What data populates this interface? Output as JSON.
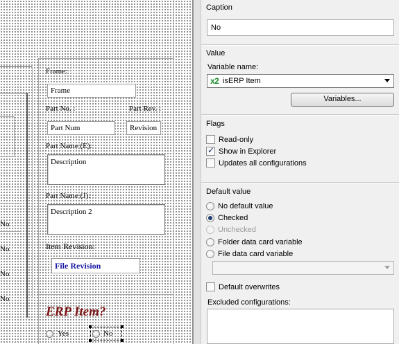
{
  "canvas": {
    "frame_label": "Frame:",
    "frame_value": "Frame",
    "part_no_label": "Part No. :",
    "part_rev_label": "Part Rev. :",
    "part_num_value": "Part Num",
    "revision_value": "Revision",
    "part_name_e_label": "Part Name (E):",
    "description_value": "Description",
    "part_name_j_label": "Part Name (J):",
    "description2_value": "Description 2",
    "item_revision_label": "Item Revision:",
    "file_revision_value": "File Revision",
    "edge_no_labels": [
      "No",
      "No",
      "No",
      "No"
    ],
    "erp_title": "ERP Item?",
    "yes_label": "Yes",
    "no_label": "No"
  },
  "panel": {
    "caption": {
      "title": "Caption",
      "value": "No"
    },
    "value": {
      "title": "Value",
      "variable_name_label": "Variable name:",
      "variable_icon": "x2",
      "variable_value": "isERP Item",
      "variables_button": "Variables..."
    },
    "flags": {
      "title": "Flags",
      "items": [
        {
          "label": "Read-only",
          "checked": false
        },
        {
          "label": "Show in Explorer",
          "checked": true
        },
        {
          "label": "Updates all configurations",
          "checked": false
        }
      ]
    },
    "default_value": {
      "title": "Default value",
      "options": [
        {
          "label": "No default value",
          "selected": false,
          "disabled": false
        },
        {
          "label": "Checked",
          "selected": true,
          "disabled": false
        },
        {
          "label": "Unchecked",
          "selected": false,
          "disabled": true
        },
        {
          "label": "Folder data card variable",
          "selected": false,
          "disabled": false
        },
        {
          "label": "File data card variable",
          "selected": false,
          "disabled": false
        }
      ],
      "file_variable_value": "",
      "default_overwrites_label": "Default overwrites",
      "default_overwrites_checked": false,
      "excluded_configurations_label": "Excluded configurations:",
      "excluded_configurations_value": ""
    }
  },
  "colors": {
    "erp_title": "#7b1414",
    "file_revision_text": "#1a1aa6",
    "variable_icon": "#1e8a2c",
    "panel_bg": "#f0f0f0"
  }
}
